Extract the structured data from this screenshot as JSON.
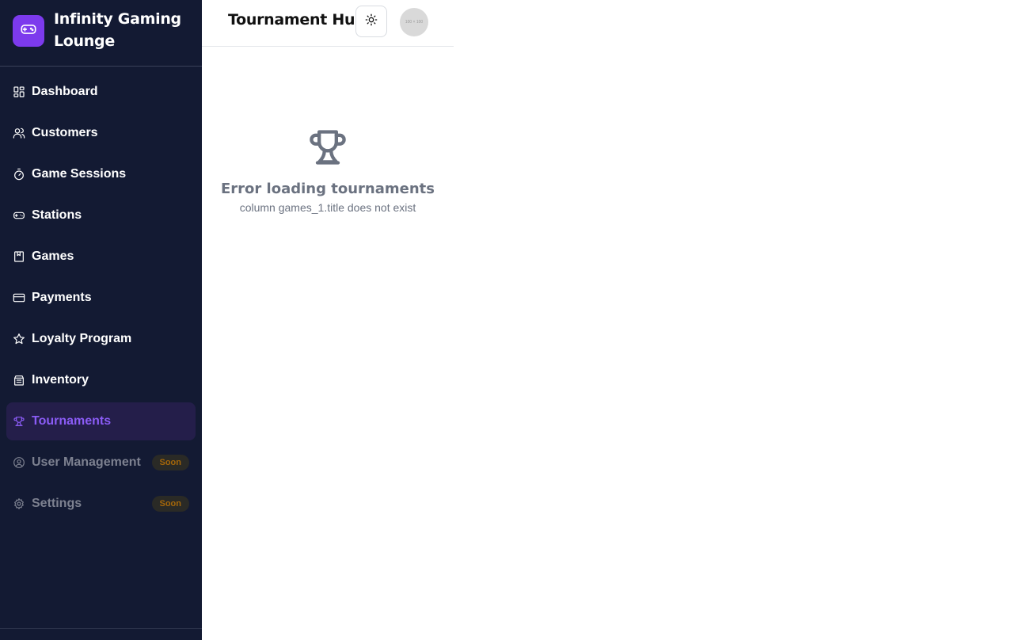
{
  "brand": {
    "name": "Infinity Gaming Lounge",
    "logo_icon": "gamepad-icon",
    "accent": "#7c3aed"
  },
  "sidebar": {
    "items": [
      {
        "label": "Dashboard",
        "icon": "dashboard-icon"
      },
      {
        "label": "Customers",
        "icon": "users-icon"
      },
      {
        "label": "Game Sessions",
        "icon": "timer-icon"
      },
      {
        "label": "Stations",
        "icon": "gamepad-icon"
      },
      {
        "label": "Games",
        "icon": "book-icon"
      },
      {
        "label": "Payments",
        "icon": "credit-card-icon"
      },
      {
        "label": "Loyalty Program",
        "icon": "star-icon"
      },
      {
        "label": "Inventory",
        "icon": "archive-icon"
      },
      {
        "label": "Tournaments",
        "icon": "trophy-icon",
        "active": true
      },
      {
        "label": "User Management",
        "icon": "user-circle-icon",
        "badge": "Soon"
      },
      {
        "label": "Settings",
        "icon": "gear-icon",
        "badge": "Soon"
      }
    ]
  },
  "header": {
    "title": "Tournament Hub",
    "theme_icon": "sun-icon",
    "avatar_text": "100 × 100"
  },
  "main": {
    "empty_icon": "trophy-icon",
    "error_title": "Error loading tournaments",
    "error_message": "column games_1.title does not exist"
  },
  "colors": {
    "sidebar_bg": "#131a33",
    "active_bg": "#241e4a",
    "active_text": "#8b5cf6",
    "badge_text": "#a3660a"
  }
}
